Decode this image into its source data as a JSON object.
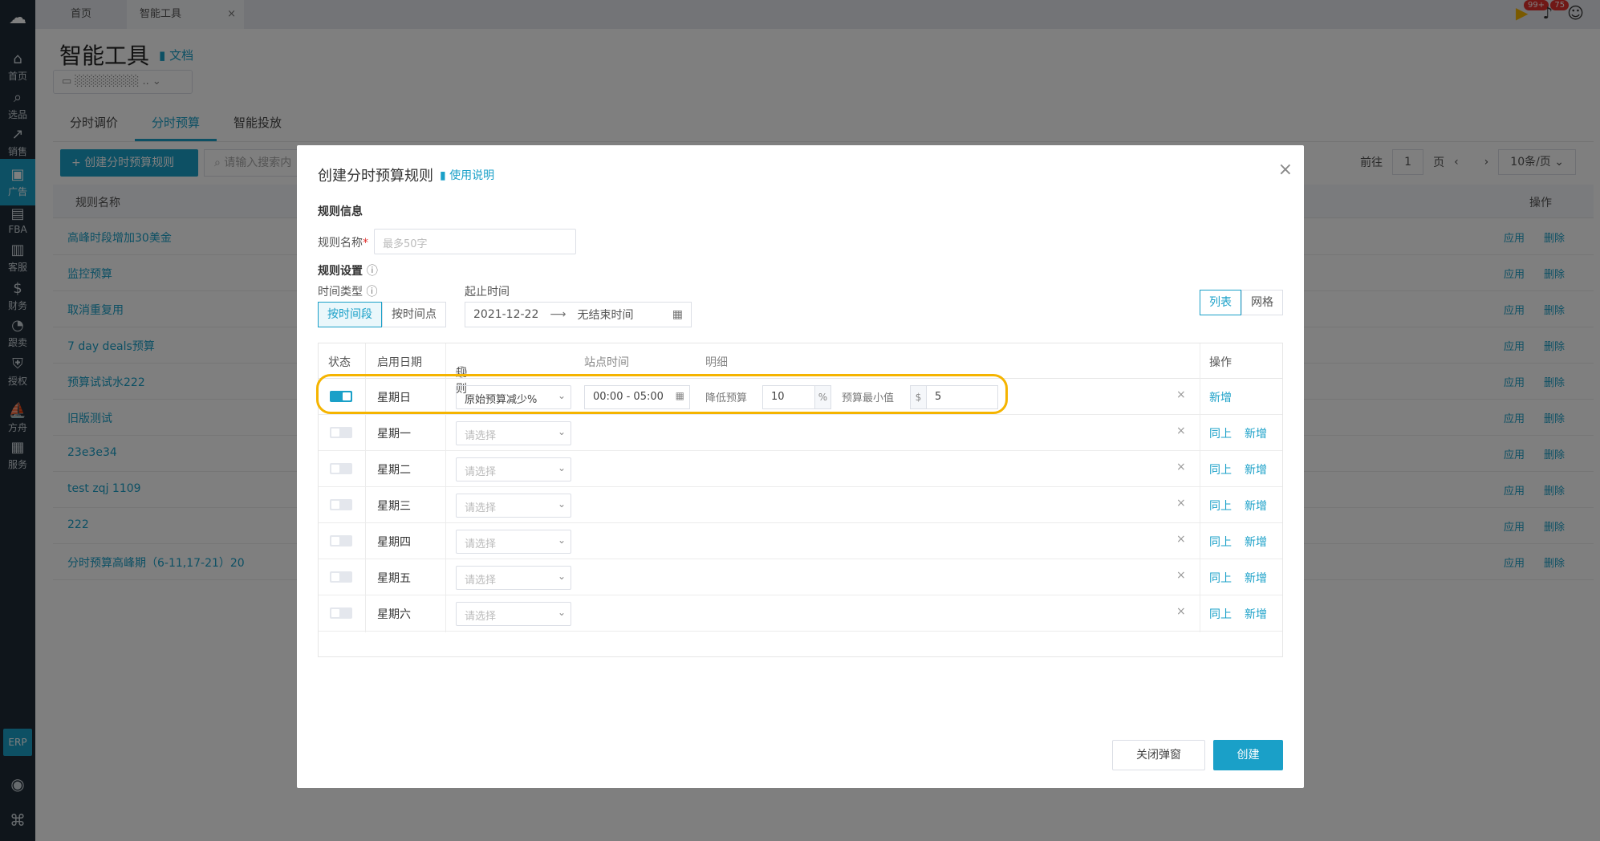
{
  "nav": {
    "items": [
      {
        "label": "首页",
        "icon": "home-icon",
        "glyph": "⌂"
      },
      {
        "label": "选品",
        "icon": "search-icon",
        "glyph": "⌕"
      },
      {
        "label": "销售",
        "icon": "chart-icon",
        "glyph": "↗"
      },
      {
        "label": "广告",
        "icon": "ad-icon",
        "glyph": "▣"
      },
      {
        "label": "FBA",
        "icon": "warehouse-icon",
        "glyph": "▤"
      },
      {
        "label": "客服",
        "icon": "service-icon",
        "glyph": "▥"
      },
      {
        "label": "财务",
        "icon": "dollar-icon",
        "glyph": "$"
      },
      {
        "label": "跟卖",
        "icon": "pie-icon",
        "glyph": "◔"
      },
      {
        "label": "授权",
        "icon": "shield-icon",
        "glyph": "⛨"
      },
      {
        "label": "方舟",
        "icon": "ark-icon",
        "glyph": "⛵"
      },
      {
        "label": "服务",
        "icon": "building-icon",
        "glyph": "▦"
      }
    ],
    "active_index": 3,
    "erp_label": "ERP"
  },
  "topbar": {
    "home_tab": "首页",
    "current_tab": "智能工具",
    "close_glyph": "×",
    "badge_play": "99+",
    "badge_bell": "75"
  },
  "page": {
    "title": "智能工具",
    "doc_link": "文档",
    "tabs": [
      "分时调价",
      "分时预算",
      "智能投放"
    ],
    "active_tab": 1,
    "create_button": "+ 创建分时预算规则",
    "search_placeholder": "请输入搜索内",
    "pager": {
      "goto": "前往",
      "page": "1",
      "page_unit": "页",
      "size": "10条/页"
    },
    "list_header": {
      "name": "规则名称",
      "ops": "操作"
    },
    "rows": [
      "高峰时段增加30美金",
      "监控预算",
      "取消重复用",
      "7 day deals预算",
      "预算试试水222",
      "旧版测试",
      "23e3e34",
      "test zqj 1109",
      "222",
      "分时预算高峰期（6-11,17-21）20"
    ],
    "row_ops": {
      "apply": "应用",
      "delete": "删除"
    }
  },
  "modal": {
    "title": "创建分时预算规则",
    "help_link": "使用说明",
    "close_glyph": "×",
    "section_info": "规则信息",
    "name_label": "规则名称",
    "name_placeholder": "最多50字",
    "section_settings": "规则设置",
    "time_type_label": "时间类型",
    "time_type_options": [
      "按时间段",
      "按时间点"
    ],
    "date_range_label": "起止时间",
    "date_start": "2021-12-22",
    "date_end": "无结束时间",
    "view_options": [
      "列表",
      "网格"
    ],
    "table": {
      "headers": {
        "status": "状态",
        "day": "启用日期",
        "rule": "规则",
        "site_time": "站点时间",
        "detail": "明细",
        "ops": "操作"
      },
      "rows": [
        {
          "day": "星期日",
          "enabled": true,
          "rule": "原始预算减少%",
          "time": "00:00 - 05:00",
          "reduce_label": "降低预算",
          "reduce_value": "10",
          "reduce_unit": "%",
          "min_label": "预算最小值",
          "min_prefix": "$",
          "min_value": "5",
          "ops": [
            "新增"
          ]
        },
        {
          "day": "星期一",
          "enabled": false,
          "rule": "请选择",
          "ops": [
            "同上",
            "新增"
          ]
        },
        {
          "day": "星期二",
          "enabled": false,
          "rule": "请选择",
          "ops": [
            "同上",
            "新增"
          ]
        },
        {
          "day": "星期三",
          "enabled": false,
          "rule": "请选择",
          "ops": [
            "同上",
            "新增"
          ]
        },
        {
          "day": "星期四",
          "enabled": false,
          "rule": "请选择",
          "ops": [
            "同上",
            "新增"
          ]
        },
        {
          "day": "星期五",
          "enabled": false,
          "rule": "请选择",
          "ops": [
            "同上",
            "新增"
          ]
        },
        {
          "day": "星期六",
          "enabled": false,
          "rule": "请选择",
          "ops": [
            "同上",
            "新增"
          ]
        }
      ],
      "remove_glyph": "×"
    },
    "close_button": "关闭弹窗",
    "create_button": "创建"
  },
  "colors": {
    "accent": "#1aa0c8",
    "highlight": "#f5b400",
    "nav_bg": "#1e2a36"
  }
}
